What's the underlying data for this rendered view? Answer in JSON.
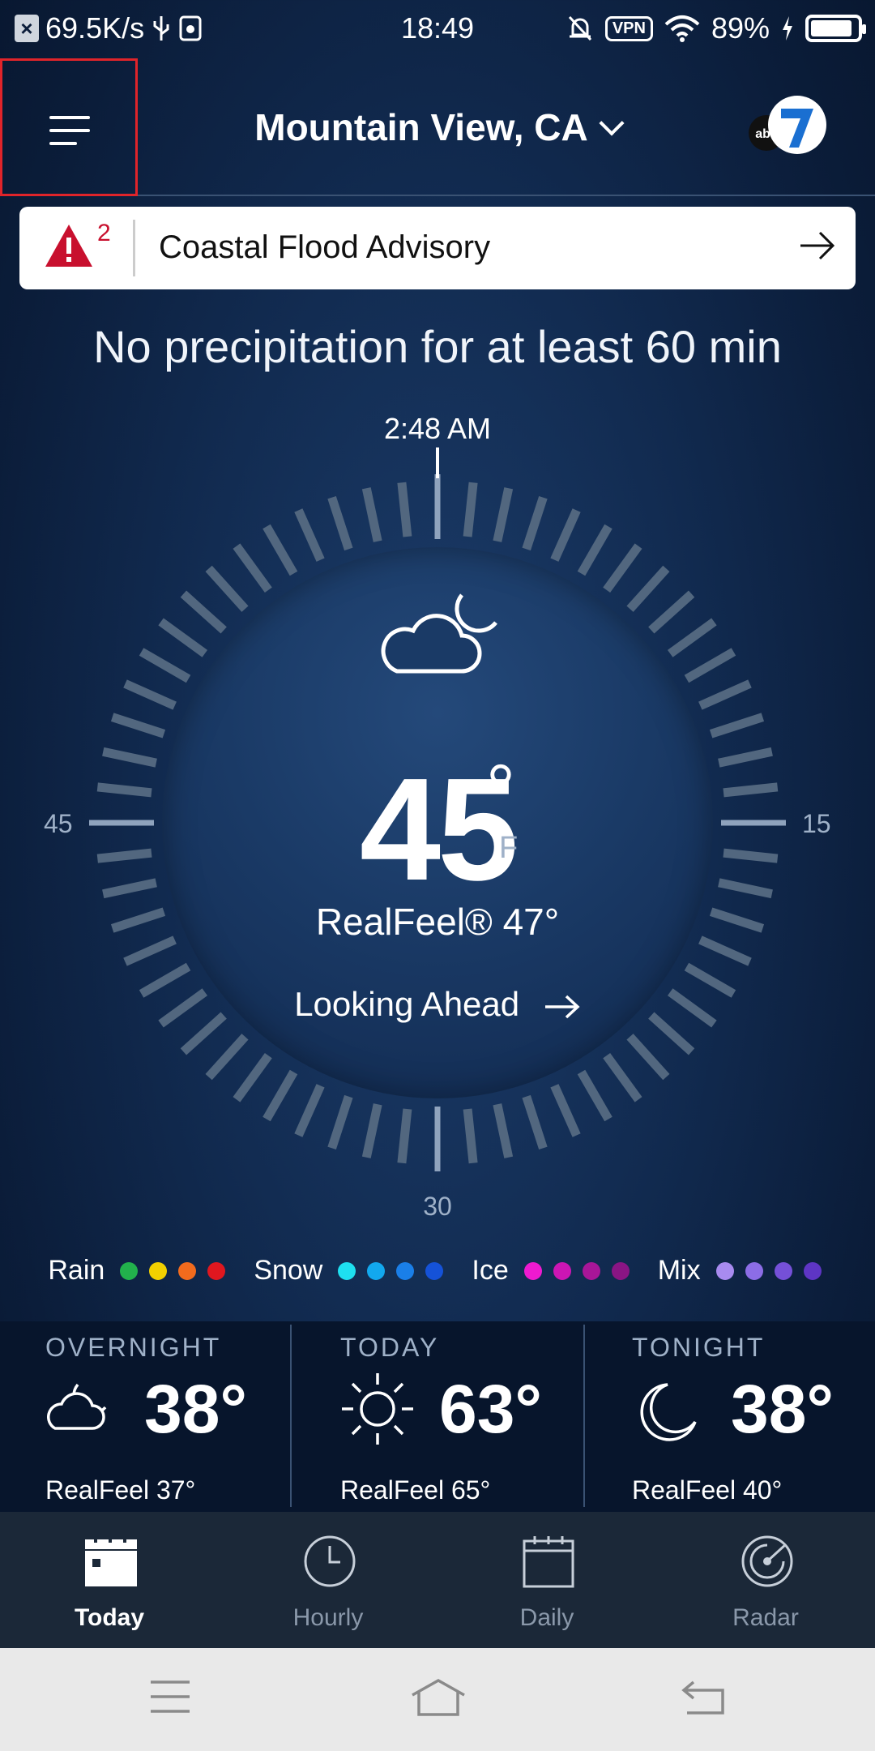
{
  "status_bar": {
    "net_speed": "69.5K/s",
    "time": "18:49",
    "vpn": "VPN",
    "battery": "89%",
    "battery_level": 0.89
  },
  "header": {
    "location": "Mountain View, CA"
  },
  "alert": {
    "count": "2",
    "text": "Coastal Flood Advisory"
  },
  "precip_message": "No precipitation for at least 60 min",
  "dial": {
    "top_time": "2:48 AM",
    "left_label": "45",
    "right_label": "15",
    "bottom_label": "30"
  },
  "current": {
    "temp": "45",
    "degree": "°",
    "unit": "F",
    "realfeel": "RealFeel® 47°",
    "looking_ahead": "Looking Ahead"
  },
  "legend": [
    {
      "label": "Rain",
      "colors": [
        "#22b14c",
        "#f2d000",
        "#f26b1d",
        "#e0171f"
      ]
    },
    {
      "label": "Snow",
      "colors": [
        "#1ee0f0",
        "#12a8ee",
        "#1a7fe8",
        "#1552d8"
      ]
    },
    {
      "label": "Ice",
      "colors": [
        "#ee1ad0",
        "#cc16b4",
        "#a81698",
        "#8a1584"
      ]
    },
    {
      "label": "Mix",
      "colors": [
        "#a88bef",
        "#8c6de6",
        "#7550d8",
        "#5e35c4"
      ]
    }
  ],
  "forecast": [
    {
      "title": "OVERNIGHT",
      "temp": "38°",
      "realfeel": "RealFeel 37°",
      "icon": "moon-cloud-icon"
    },
    {
      "title": "TODAY",
      "temp": "63°",
      "realfeel": "RealFeel 65°",
      "icon": "sun-icon"
    },
    {
      "title": "TONIGHT",
      "temp": "38°",
      "realfeel": "RealFeel 40°",
      "icon": "moon-icon"
    }
  ],
  "tabs": [
    {
      "label": "Today",
      "icon": "calendar-day-icon",
      "active": true
    },
    {
      "label": "Hourly",
      "icon": "clock-icon",
      "active": false
    },
    {
      "label": "Daily",
      "icon": "calendar-icon",
      "active": false
    },
    {
      "label": "Radar",
      "icon": "radar-icon",
      "active": false
    }
  ]
}
